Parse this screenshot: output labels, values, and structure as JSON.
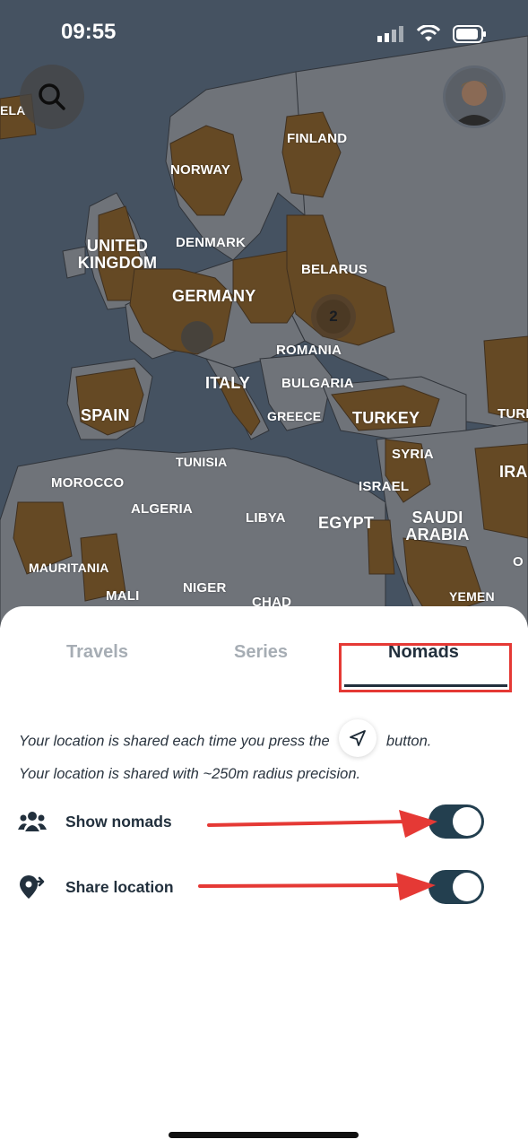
{
  "status_bar": {
    "time": "09:55"
  },
  "map": {
    "labels": {
      "ela": "ELA",
      "finland": "FINLAND",
      "norway": "NORWAY",
      "united_kingdom": "UNITED KINGDOM",
      "denmark": "DENMARK",
      "belarus": "BELARUS",
      "germany": "GERMANY",
      "romania": "ROMANIA",
      "italy": "ITALY",
      "bulgaria": "BULGARIA",
      "spain": "SPAIN",
      "greece": "GREECE",
      "turkey": "TURKEY",
      "turk": "TURK",
      "syria": "SYRIA",
      "tunisia": "TUNISIA",
      "ira": "IRA",
      "morocco": "MOROCCO",
      "israel": "ISRAEL",
      "algeria": "ALGERIA",
      "libya": "LIBYA",
      "egypt": "EGYPT",
      "saudi_arabia": "SAUDI ARABIA",
      "mauritania": "MAURITANIA",
      "o": "O",
      "mali": "MALI",
      "niger": "NIGER",
      "chad": "CHAD",
      "yemen": "YEMEN"
    },
    "cluster_count": "2",
    "visited_color": "#d98a1f"
  },
  "tabs": [
    {
      "label": "Travels",
      "active": false
    },
    {
      "label": "Series",
      "active": false
    },
    {
      "label": "Nomads",
      "active": true
    }
  ],
  "info": {
    "line1_before": "Your location is shared each time you press the",
    "line1_after": "button.",
    "line2": "Your location is shared with ~250m radius precision."
  },
  "settings": [
    {
      "label": "Show nomads",
      "icon": "users-icon",
      "enabled": true
    },
    {
      "label": "Share location",
      "icon": "share-location-icon",
      "enabled": true
    }
  ],
  "annotation_color": "#e53935"
}
